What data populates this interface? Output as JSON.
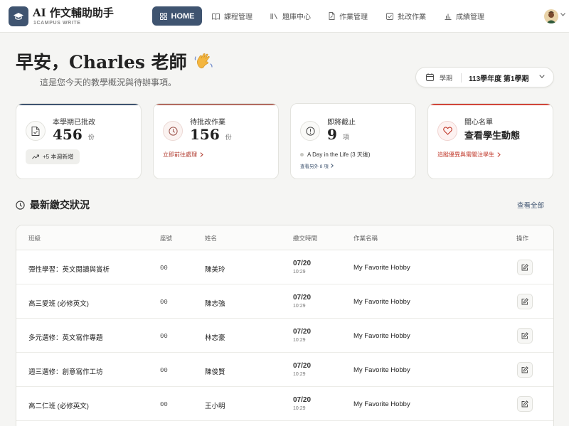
{
  "app": {
    "title": "AI 作文輔助助手",
    "subtitle": "1CAMPUS WRITE"
  },
  "nav": {
    "home": "HOME",
    "items": [
      "課程管理",
      "題庫中心",
      "作業管理",
      "批改作業",
      "成績管理"
    ]
  },
  "greeting": {
    "title": "早安，Charles 老師",
    "subtitle": "這是您今天的教學概況與待辦事項。"
  },
  "semester": {
    "label": "學期",
    "value": "113學年度 第1學期"
  },
  "cards": {
    "graded": {
      "label": "本學期已批改",
      "value": "456",
      "unit": "份",
      "badge": "+5 本週新增"
    },
    "pending": {
      "label": "待批改作業",
      "value": "156",
      "unit": "份",
      "link": "立即前往處理"
    },
    "due": {
      "label": "即將截止",
      "value": "9",
      "unit": "項",
      "item": "A Day in the Life (3 天後)",
      "more": "查看另外 8 項"
    },
    "care": {
      "label": "關心名單",
      "value": "查看學生動態",
      "link": "追蹤優異與需關注學生"
    }
  },
  "section": {
    "title": "最新繳交狀況",
    "view_all": "查看全部"
  },
  "table": {
    "headers": [
      "班級",
      "座號",
      "姓名",
      "繳交時間",
      "作業名稱",
      "操作"
    ],
    "rows": [
      {
        "class": "彈性學習：英文閱讀與賞析",
        "seat": "00",
        "name": "陳美玲",
        "date": "07/20",
        "time": "10:29",
        "assignment": "My Favorite Hobby"
      },
      {
        "class": "高三愛班 (必修英文)",
        "seat": "00",
        "name": "陳志強",
        "date": "07/20",
        "time": "10:29",
        "assignment": "My Favorite Hobby"
      },
      {
        "class": "多元選修：英文寫作專題",
        "seat": "00",
        "name": "林志豪",
        "date": "07/20",
        "time": "10:29",
        "assignment": "My Favorite Hobby"
      },
      {
        "class": "週三選修：創意寫作工坊",
        "seat": "00",
        "name": "陳俊賢",
        "date": "07/20",
        "time": "10:29",
        "assignment": "My Favorite Hobby"
      },
      {
        "class": "高二仁班 (必修英文)",
        "seat": "00",
        "name": "王小明",
        "date": "07/20",
        "time": "10:29",
        "assignment": "My Favorite Hobby"
      }
    ]
  },
  "colors": {
    "primary": "#3f5470",
    "accent_red": "#c0392b",
    "background": "#f5f5f3"
  }
}
